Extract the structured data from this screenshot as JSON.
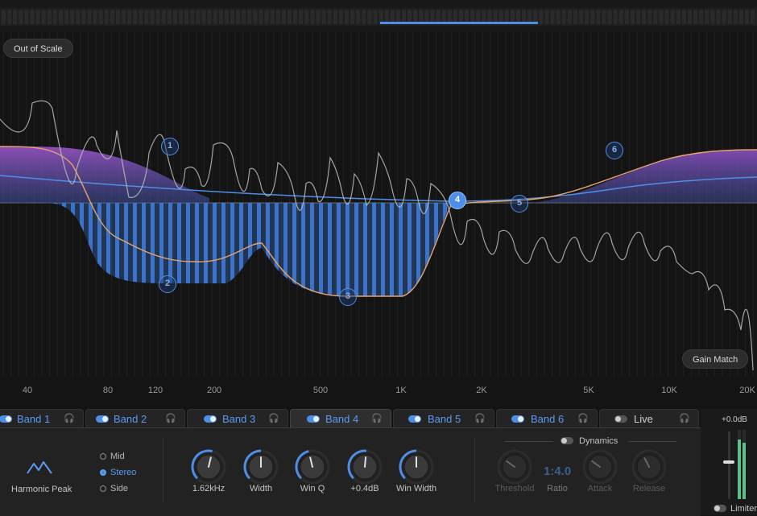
{
  "graph": {
    "out_of_scale": "Out of Scale",
    "gain_match": "Gain Match",
    "nodes": [
      "1",
      "2",
      "3",
      "4",
      "5",
      "6"
    ],
    "freq_labels": [
      "40",
      "80",
      "120",
      "200",
      "500",
      "1K",
      "2K",
      "5K",
      "10K",
      "20K"
    ]
  },
  "bands": [
    {
      "label": "Band 1",
      "enabled": true
    },
    {
      "label": "Band 2",
      "enabled": true
    },
    {
      "label": "Band 3",
      "enabled": true
    },
    {
      "label": "Band 4",
      "enabled": true
    },
    {
      "label": "Band 5",
      "enabled": true
    },
    {
      "label": "Band 6",
      "enabled": true
    },
    {
      "label": "Live",
      "enabled": false
    }
  ],
  "shape": {
    "label": "Harmonic Peak",
    "icon": "harmonic-peak-icon"
  },
  "stereo": {
    "options": [
      "Mid",
      "Stereo",
      "Side"
    ],
    "selected": "Stereo"
  },
  "knobs": [
    {
      "label": "1.62kHz",
      "level": 0.55
    },
    {
      "label": "Width",
      "level": 0.5
    },
    {
      "label": "Win Q",
      "level": 0.45
    },
    {
      "label": "+0.4dB",
      "level": 0.52
    },
    {
      "label": "Win Width",
      "level": 0.5
    }
  ],
  "dynamics": {
    "label": "Dynamics",
    "enabled": false,
    "threshold_label": "Threshold",
    "ratio_value": "1:4.0",
    "ratio_label": "Ratio",
    "attack_label": "Attack",
    "release_label": "Release"
  },
  "output": {
    "gain": "+0.0dB",
    "limiter_label": "Limiter"
  },
  "colors": {
    "accent": "#4d8fe8",
    "purple": "#8a4fbf",
    "orange": "#e8a36a",
    "background": "#141414"
  }
}
